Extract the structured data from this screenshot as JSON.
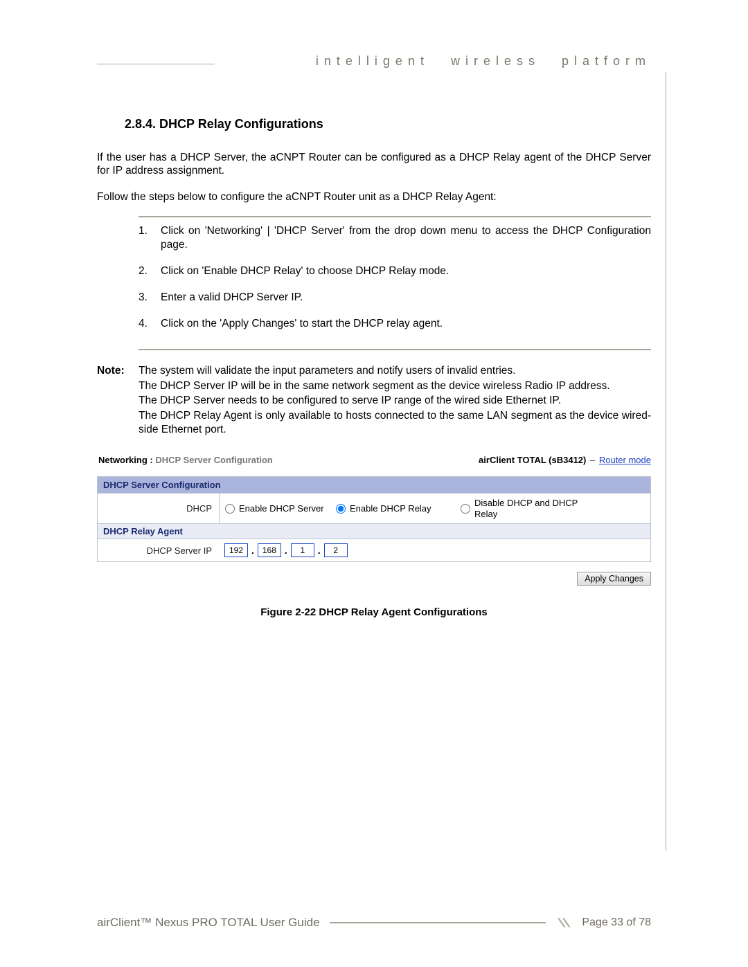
{
  "header": {
    "tagline": "intelligent wireless platform"
  },
  "section": {
    "number_title": "2.8.4.  DHCP Relay Configurations",
    "intro1": "If the user has a DHCP Server, the aCNPT Router can be configured as a DHCP Relay agent of the DHCP Server for IP address assignment.",
    "intro2": "Follow the steps below to configure the aCNPT Router unit as a DHCP Relay Agent:",
    "steps": [
      "Click on 'Networking' | 'DHCP Server' from the drop down menu to access the DHCP Configuration page.",
      "Click on 'Enable DHCP Relay' to choose DHCP Relay mode.",
      "Enter a valid DHCP Server IP.",
      "Click on the 'Apply Changes' to start the DHCP relay agent."
    ],
    "note_label": "Note:",
    "note_lines": [
      "The system will validate the input parameters and notify users of invalid entries.",
      "The DHCP Server IP will be in the same network segment as the device wireless Radio IP address.",
      "The DHCP Server needs to be configured to serve IP range of the wired side Ethernet IP.",
      "The DHCP Relay Agent is only available to hosts connected to the same LAN segment as the device wired-side Ethernet port."
    ],
    "figure": {
      "breadcrumb_prefix": "Networking : ",
      "breadcrumb_title": "DHCP Server Configuration",
      "device_name": "airClient TOTAL (sB3412)",
      "mode_link": "Router mode",
      "panel_header": "DHCP Server Configuration",
      "dhcp_row_label": "DHCP",
      "options": {
        "enable_dhcp": "Enable DHCP Server",
        "enable_relay": "Enable DHCP Relay",
        "disable_both": "Disable DHCP and DHCP Relay"
      },
      "selected_option": "enable_relay",
      "sub_header": "DHCP Relay Agent",
      "ip_row_label": "DHCP Server IP",
      "ip": [
        "192",
        "168",
        "1",
        "2"
      ],
      "apply_label": "Apply Changes",
      "caption": "Figure 2-22 DHCP Relay Agent Configurations"
    }
  },
  "footer": {
    "title": "airClient™ Nexus PRO TOTAL User Guide",
    "page": "Page 33 of 78"
  }
}
